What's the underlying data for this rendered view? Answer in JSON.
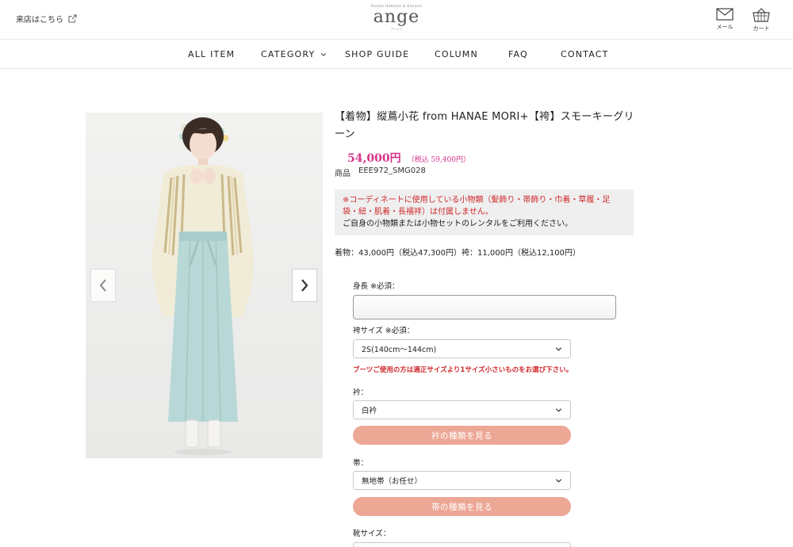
{
  "header": {
    "store_link": "来店はこちら",
    "logo_tagline": "Rental Hakama & Kimono",
    "logo_word": "ange",
    "logo_sub": "アンジュ",
    "mail_label": "メール",
    "cart_label": "カート"
  },
  "nav": {
    "all_item": "ALL ITEM",
    "category": "CATEGORY",
    "shop_guide": "SHOP GUIDE",
    "column": "COLUMN",
    "faq": "FAQ",
    "contact": "CONTACT"
  },
  "product": {
    "title": "【着物】縦蔦小花 from HANAE MORI+【袴】スモーキーグリーン",
    "price": "54,000円",
    "price_tax": "（税込 59,400円）",
    "sku_label": "商品",
    "sku": "EEE972_SMG028",
    "notice_red": "※コーディネートに使用している小物類（髪飾り・帯飾り・巾着・草履・足袋・紐・肌着・長襦袢）は付属しません。",
    "notice_dark": "ご自身の小物類または小物セットのレンタルをご利用ください。",
    "breakdown": "着物：43,000円（税込47,300円）袴：11,000円（税込12,100円）"
  },
  "form": {
    "height_label": "身長 ※必須：",
    "height_value": "",
    "hakama_size_label": "袴サイズ ※必須：",
    "hakama_size_value": "2S(140cm～144cm)",
    "boots_warning": "ブーツご使用の方は適正サイズより1サイズ小さいものをお選び下さい。",
    "collar_label": "衿：",
    "collar_value": "白衿",
    "collar_button": "衿の種類を見る",
    "obi_label": "帯：",
    "obi_value": "無地帯（お任せ）",
    "obi_button": "帯の種類を見る",
    "shoe_size_label": "靴サイズ："
  },
  "icons": {
    "external": "external-link-icon",
    "mail": "mail-icon",
    "cart": "cart-icon",
    "chevron": "chevron-down-icon",
    "prev": "chevron-left-icon",
    "next": "chevron-right-icon"
  },
  "colors": {
    "price": "#d6338a",
    "warning": "#d0282b",
    "pill_button": "#eda795"
  }
}
